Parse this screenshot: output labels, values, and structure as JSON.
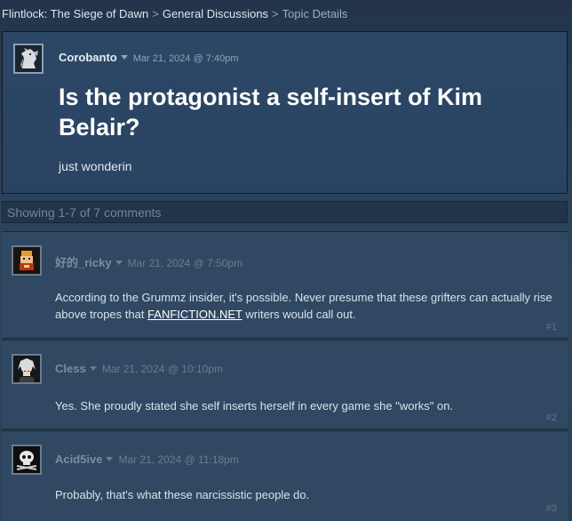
{
  "breadcrumb": {
    "game": "Flintlock: The Siege of Dawn",
    "forum": "General Discussions",
    "current": "Topic Details",
    "separator": ">"
  },
  "topic": {
    "author": "Corobanto",
    "date": "Mar 21, 2024 @ 7:40pm",
    "title": "Is the protagonist a self-insert of Kim Belair?",
    "body": "just wonderin",
    "avatar_icon": "white-horse-avatar"
  },
  "showing": "Showing 1-7 of 7 comments",
  "comments": [
    {
      "author": "好的_ricky",
      "date": "Mar 21, 2024 @ 7:50pm",
      "text_before": "According to the Grummz insider, it's possible. Never presume that these grifters can actually rise above tropes that ",
      "link": "FANFICTION.NET",
      "text_after": " writers would call out.",
      "index": "#1",
      "avatar_icon": "pixel-character-avatar"
    },
    {
      "author": "Cless",
      "date": "Mar 21, 2024 @ 10:10pm",
      "text": "Yes. She proudly stated she self inserts herself in every game she \"works\" on.",
      "index": "#2",
      "avatar_icon": "silver-hair-avatar"
    },
    {
      "author": "Acid5ive",
      "date": "Mar 21, 2024 @ 11:18pm",
      "text": "Probably, that's what these narcissistic people do.",
      "index": "#3",
      "avatar_icon": "skull-avatar"
    }
  ]
}
